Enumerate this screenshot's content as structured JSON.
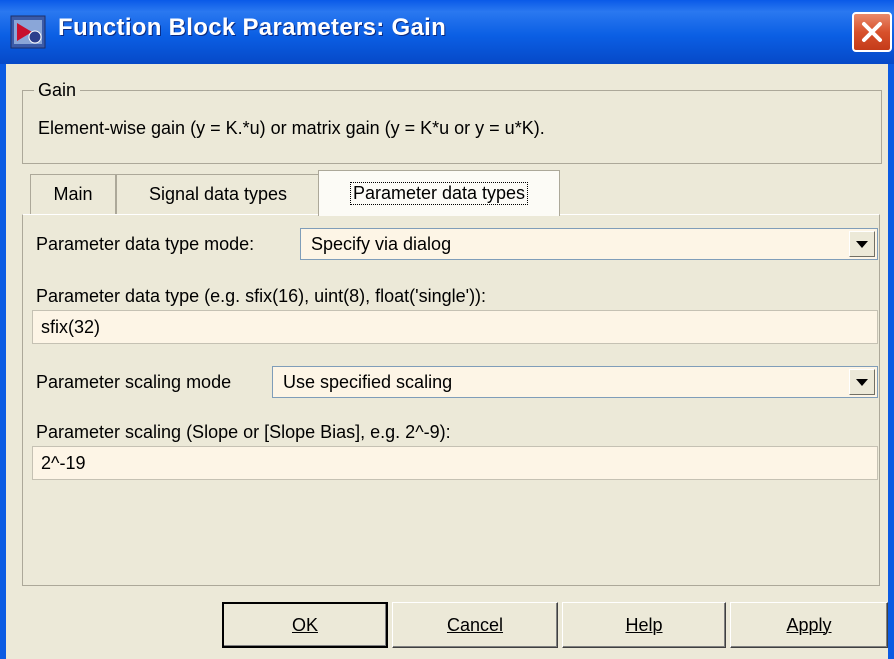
{
  "window": {
    "title": "Function Block Parameters: Gain",
    "icon": "simulink-block-icon",
    "close_icon": "close-icon"
  },
  "group": {
    "legend": "Gain",
    "description": "Element-wise gain (y = K.*u) or matrix gain (y = K*u or y = u*K)."
  },
  "tabs": [
    {
      "label": "Main"
    },
    {
      "label": "Signal data types"
    },
    {
      "label": "Parameter data types"
    }
  ],
  "active_tab": "Parameter data types",
  "params": {
    "dtype_mode_label": "Parameter data type mode:",
    "dtype_mode_value": "Specify via dialog",
    "dtype_label": "Parameter data type (e.g. sfix(16), uint(8), float('single')):",
    "dtype_value": "sfix(32)",
    "scaling_mode_label": "Parameter scaling mode",
    "scaling_mode_value": "Use specified scaling",
    "scaling_label": "Parameter scaling (Slope or [Slope Bias], e.g. 2^-9):",
    "scaling_value": "2^-19"
  },
  "buttons": {
    "ok": "OK",
    "cancel": "Cancel",
    "help": "Help",
    "apply": "Apply"
  },
  "colors": {
    "titlebar": "#0b5fe4",
    "dialog_bg": "#ece9d8",
    "field_bg": "#fdf5e6",
    "close_button": "#d8512c"
  }
}
